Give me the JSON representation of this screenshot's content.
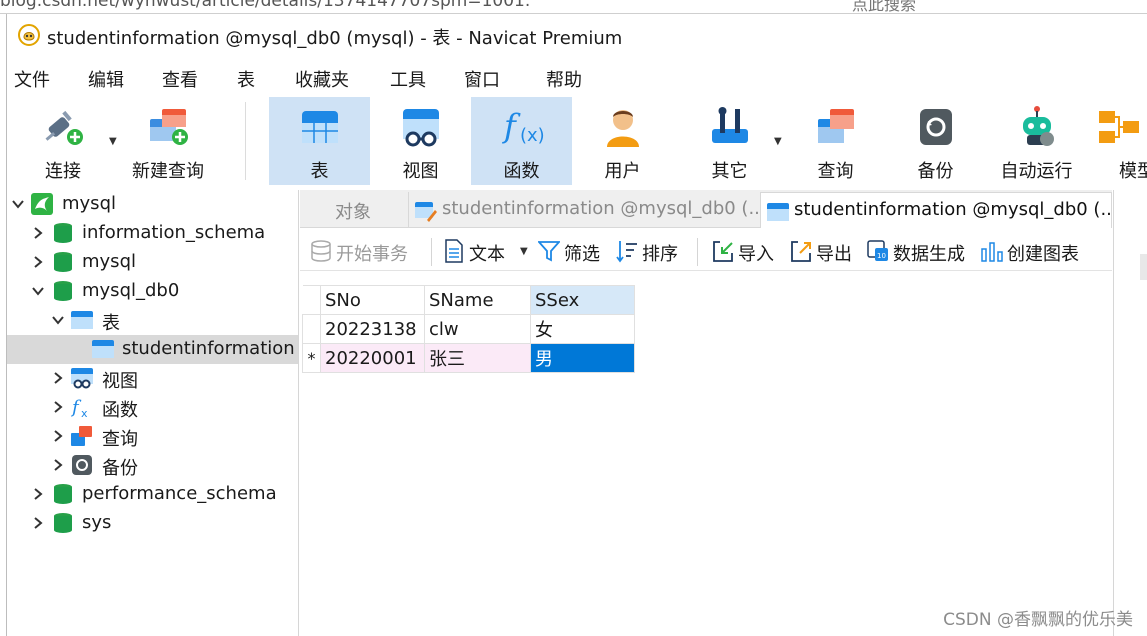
{
  "browser": {
    "url_fragment": "blog.csdn.net/wyhwust/article/details/1374147707spm=1001.",
    "search_ghost": "点此搜索"
  },
  "window": {
    "title": "studentinformation @mysql_db0 (mysql) - 表 - Navicat Premium"
  },
  "menu": [
    "文件",
    "编辑",
    "查看",
    "表",
    "收藏夹",
    "工具",
    "窗口",
    "帮助"
  ],
  "toolbar": {
    "connect": "连接",
    "new_query": "新建查询",
    "table": "表",
    "view": "视图",
    "function": "函数",
    "user": "用户",
    "other": "其它",
    "query": "查询",
    "backup": "备份",
    "automation": "自动运行",
    "model": "模型"
  },
  "tree": {
    "root": "mysql",
    "db_information_schema": "information_schema",
    "db_mysql": "mysql",
    "db_mysql_db0": "mysql_db0",
    "tables": "表",
    "table_studentinformation": "studentinformation",
    "views": "视图",
    "functions": "函数",
    "queries": "查询",
    "backups": "备份",
    "db_performance_schema": "performance_schema",
    "db_sys": "sys"
  },
  "tabs": {
    "objects": "对象",
    "tab_design": "studentinformation @mysql_db0 (...",
    "tab_data": "studentinformation @mysql_db0 (..."
  },
  "data_toolbar": {
    "begin_transaction": "开始事务",
    "text": "文本",
    "filter": "筛选",
    "sort": "排序",
    "import": "导入",
    "export": "导出",
    "data_generation": "数据生成",
    "create_chart": "创建图表"
  },
  "grid": {
    "columns": [
      "SNo",
      "SName",
      "SSex"
    ],
    "rows": [
      {
        "marker": "",
        "SNo": "20223138",
        "SName": "clw",
        "SSex": "女"
      },
      {
        "marker": "*",
        "SNo": "20220001",
        "SName": "张三",
        "SSex": "男"
      }
    ]
  },
  "watermark": "CSDN @香飘飘的优乐美",
  "colors": {
    "active_toolbar_bg": "#cfe2f5",
    "selected_cell": "#0078d7",
    "new_row_tint": "#fbeaf7",
    "db_icon_green": "#1e9e4a"
  }
}
